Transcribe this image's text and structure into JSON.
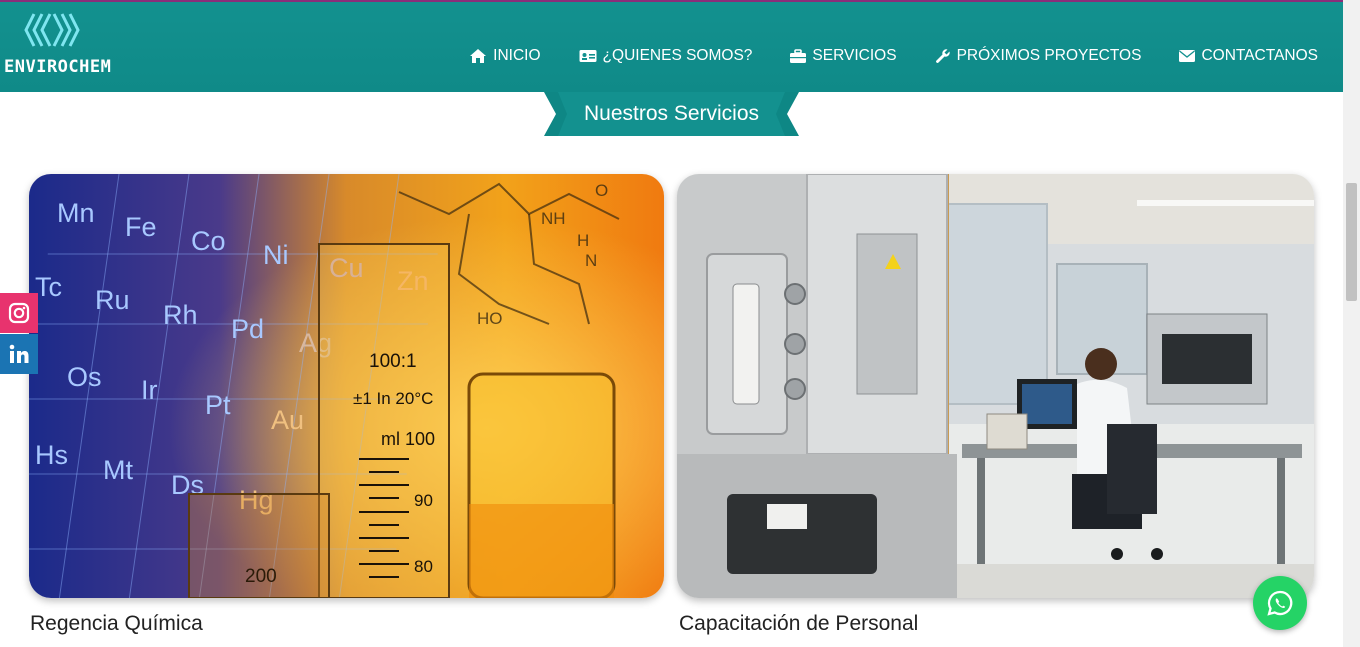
{
  "brand": {
    "name": "ENVIROCHEM",
    "logo_icon": "wave-chevron-logo-icon"
  },
  "nav": {
    "items": [
      {
        "label": "INICIO",
        "icon": "home-icon"
      },
      {
        "label": "¿QUIENES SOMOS?",
        "icon": "id-card-icon"
      },
      {
        "label": "SERVICIOS",
        "icon": "briefcase-icon"
      },
      {
        "label": "PRÓXIMOS PROYECTOS",
        "icon": "wrench-icon"
      },
      {
        "label": "CONTACTANOS",
        "icon": "envelope-icon"
      }
    ]
  },
  "section": {
    "title": "Nuestros Servicios"
  },
  "services": [
    {
      "title": "Regencia Química",
      "image": "periodic-table-lab-glassware"
    },
    {
      "title": "Capacitación de Personal",
      "image": "laboratory-technician-workstation"
    }
  ],
  "image_text": {
    "measure_ratio": "100:1",
    "measure_temp": "±1 In 20°C",
    "measure_ml": "ml 100",
    "tick_90": "90",
    "tick_80": "80",
    "tick_200": "200",
    "elements": [
      "Mn",
      "Fe",
      "Co",
      "Ni",
      "Cu",
      "Zn",
      "Tc",
      "Ru",
      "Rh",
      "Pd",
      "Ag",
      "Os",
      "Ir",
      "Pt",
      "Au",
      "Hs",
      "Mt",
      "Ds",
      "Hg"
    ],
    "molecule_nh": "NH",
    "molecule_h": "H",
    "molecule_n": "N",
    "molecule_o": "O",
    "molecule_ho": "HO"
  },
  "social": [
    {
      "name": "instagram",
      "icon": "instagram-icon"
    },
    {
      "name": "linkedin",
      "icon": "linkedin-icon"
    }
  ],
  "floating": {
    "icon": "whatsapp-icon"
  },
  "colors": {
    "header": "#0f8a88",
    "accent": "#13918f",
    "instagram": "#e8336e",
    "linkedin": "#1b74b3",
    "whatsapp": "#25d366"
  }
}
